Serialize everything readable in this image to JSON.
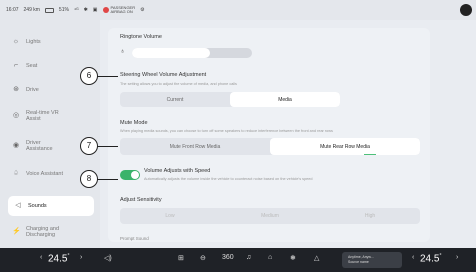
{
  "statusbar": {
    "time": "16:07",
    "range": "249 km",
    "battery": "51%",
    "airbag_line1": "PASSENGER",
    "airbag_line2": "AIRBAG ON"
  },
  "sidebar": {
    "items": [
      {
        "label": "Lights",
        "icon": "lights-icon",
        "glyph": "☼"
      },
      {
        "label": "Seat",
        "icon": "seat-icon",
        "glyph": "⌐"
      },
      {
        "label": "Drive",
        "icon": "drive-icon",
        "glyph": "⊛"
      },
      {
        "label": "Real-time VR Assist",
        "icon": "vr-assist-icon",
        "glyph": "◎"
      },
      {
        "label": "Driver Assistance",
        "icon": "driver-assistance-icon",
        "glyph": "◉"
      },
      {
        "label": "Voice Assistant",
        "icon": "voice-icon",
        "glyph": "♤"
      },
      {
        "label": "Sounds",
        "icon": "speaker-icon",
        "glyph": "◁"
      },
      {
        "label": "Charging and Discharging",
        "icon": "charging-icon",
        "glyph": "⚡"
      }
    ]
  },
  "ringtone": {
    "title": "Ringtone Volume",
    "level": 0.65
  },
  "steering": {
    "title": "Steering Wheel Volume Adjustment",
    "desc": "The setting allows you to adjust the volume of media, and phone calls",
    "options": [
      "Current",
      "Media"
    ],
    "selected": "Media"
  },
  "mute": {
    "title": "Mute Mode",
    "desc": "When playing media sounds, you can choose to turn off some speakers to reduce interference between the front and rear rows",
    "options": [
      "Mute Front Row Media",
      "Mute Rear Row Media"
    ],
    "selected": "Mute Rear Row Media"
  },
  "speed": {
    "title": "Volume Adjusts with Speed",
    "desc": "Automatically adjusts the volume inside the vehicle to counteract noise based on the vehicle's speed",
    "enabled": true
  },
  "sensitivity": {
    "title": "Adjust Sensitivity",
    "options": [
      "Low",
      "Medium",
      "High"
    ]
  },
  "prompt": {
    "title": "Prompt Sound"
  },
  "callouts": [
    "6",
    "7",
    "8"
  ],
  "taskbar": {
    "left_temp": "24.5",
    "right_temp": "24.5",
    "degree": "°",
    "media_line1": "Anytime, Anyw...",
    "media_line2": "Source name"
  },
  "colors": {
    "accent_green": "#3ab36a",
    "taskbar_bg": "#1f2227"
  }
}
